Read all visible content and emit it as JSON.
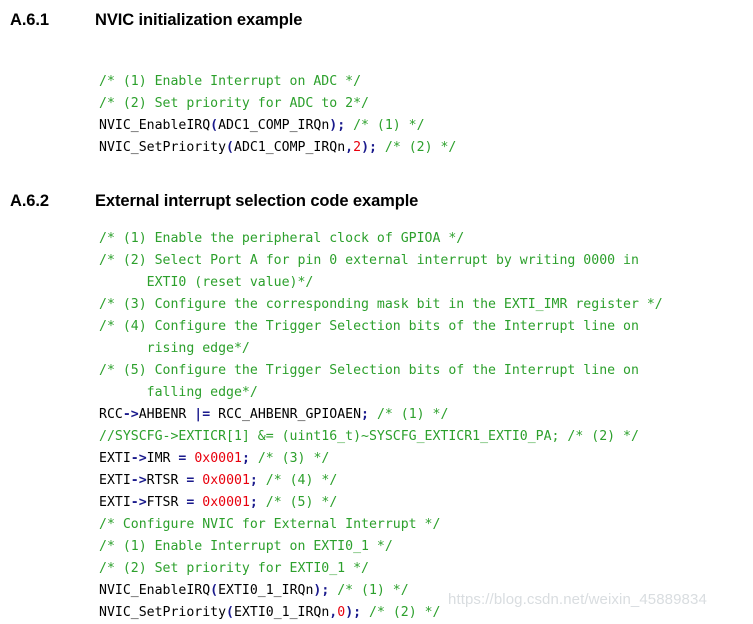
{
  "document": {
    "background_color": "#ffffff",
    "sections": [
      {
        "number": "A.6.1",
        "title": "NVIC initialization example",
        "code_lines": [
          [
            {
              "t": "comment",
              "s": "/* (1) Enable Interrupt on ADC */"
            }
          ],
          [
            {
              "t": "comment",
              "s": "/* (2) Set priority for ADC to 2*/"
            }
          ],
          [
            {
              "t": "plain",
              "s": "NVIC_EnableIRQ"
            },
            {
              "t": "punct",
              "s": "("
            },
            {
              "t": "plain",
              "s": "ADC1_COMP_IRQn"
            },
            {
              "t": "punct",
              "s": ");"
            },
            {
              "t": "comment",
              "s": " /* (1) */"
            }
          ],
          [
            {
              "t": "plain",
              "s": "NVIC_SetPriority"
            },
            {
              "t": "punct",
              "s": "("
            },
            {
              "t": "plain",
              "s": "ADC1_COMP_IRQn"
            },
            {
              "t": "punct",
              "s": ","
            },
            {
              "t": "number",
              "s": "2"
            },
            {
              "t": "punct",
              "s": ");"
            },
            {
              "t": "comment",
              "s": " /* (2) */"
            }
          ]
        ]
      },
      {
        "number": "A.6.2",
        "title": "External interrupt selection code example",
        "code_lines": [
          [
            {
              "t": "comment",
              "s": "/* (1) Enable the peripheral clock of GPIOA */"
            }
          ],
          [
            {
              "t": "comment",
              "s": "/* (2) Select Port A for pin 0 external interrupt by writing 0000 in"
            }
          ],
          [
            {
              "t": "comment",
              "s": "      EXTI0 (reset value)*/"
            }
          ],
          [
            {
              "t": "comment",
              "s": "/* (3) Configure the corresponding mask bit in the EXTI_IMR register */"
            }
          ],
          [
            {
              "t": "comment",
              "s": "/* (4) Configure the Trigger Selection bits of the Interrupt line on"
            }
          ],
          [
            {
              "t": "comment",
              "s": "      rising edge*/"
            }
          ],
          [
            {
              "t": "comment",
              "s": "/* (5) Configure the Trigger Selection bits of the Interrupt line on"
            }
          ],
          [
            {
              "t": "comment",
              "s": "      falling edge*/"
            }
          ],
          [
            {
              "t": "plain",
              "s": "RCC"
            },
            {
              "t": "op",
              "s": "->"
            },
            {
              "t": "plain",
              "s": "AHBENR "
            },
            {
              "t": "op",
              "s": "|="
            },
            {
              "t": "plain",
              "s": " RCC_AHBENR_GPIOAEN"
            },
            {
              "t": "punct",
              "s": ";"
            },
            {
              "t": "comment",
              "s": " /* (1) */"
            }
          ],
          [
            {
              "t": "comment",
              "s": "//SYSCFG->EXTICR[1] &= (uint16_t)~SYSCFG_EXTICR1_EXTI0_PA; /* (2) */"
            }
          ],
          [
            {
              "t": "plain",
              "s": "EXTI"
            },
            {
              "t": "op",
              "s": "->"
            },
            {
              "t": "plain",
              "s": "IMR "
            },
            {
              "t": "op",
              "s": "="
            },
            {
              "t": "plain",
              "s": " "
            },
            {
              "t": "number",
              "s": "0x0001"
            },
            {
              "t": "punct",
              "s": ";"
            },
            {
              "t": "comment",
              "s": " /* (3) */"
            }
          ],
          [
            {
              "t": "plain",
              "s": "EXTI"
            },
            {
              "t": "op",
              "s": "->"
            },
            {
              "t": "plain",
              "s": "RTSR "
            },
            {
              "t": "op",
              "s": "="
            },
            {
              "t": "plain",
              "s": " "
            },
            {
              "t": "number",
              "s": "0x0001"
            },
            {
              "t": "punct",
              "s": ";"
            },
            {
              "t": "comment",
              "s": " /* (4) */"
            }
          ],
          [
            {
              "t": "plain",
              "s": "EXTI"
            },
            {
              "t": "op",
              "s": "->"
            },
            {
              "t": "plain",
              "s": "FTSR "
            },
            {
              "t": "op",
              "s": "="
            },
            {
              "t": "plain",
              "s": " "
            },
            {
              "t": "number",
              "s": "0x0001"
            },
            {
              "t": "punct",
              "s": ";"
            },
            {
              "t": "comment",
              "s": " /* (5) */"
            }
          ],
          [
            {
              "t": "comment",
              "s": "/* Configure NVIC for External Interrupt */"
            }
          ],
          [
            {
              "t": "comment",
              "s": "/* (1) Enable Interrupt on EXTI0_1 */"
            }
          ],
          [
            {
              "t": "comment",
              "s": "/* (2) Set priority for EXTI0_1 */"
            }
          ],
          [
            {
              "t": "plain",
              "s": "NVIC_EnableIRQ"
            },
            {
              "t": "punct",
              "s": "("
            },
            {
              "t": "plain",
              "s": "EXTI0_1_IRQn"
            },
            {
              "t": "punct",
              "s": ");"
            },
            {
              "t": "comment",
              "s": " /* (1) */"
            }
          ],
          [
            {
              "t": "plain",
              "s": "NVIC_SetPriority"
            },
            {
              "t": "punct",
              "s": "("
            },
            {
              "t": "plain",
              "s": "EXTI0_1_IRQn"
            },
            {
              "t": "punct",
              "s": ","
            },
            {
              "t": "number",
              "s": "0"
            },
            {
              "t": "punct",
              "s": ");"
            },
            {
              "t": "comment",
              "s": " /* (2) */"
            }
          ]
        ]
      }
    ],
    "watermark": "https://blog.csdn.net/weixin_45889834",
    "syntax_colors": {
      "comment": "#2ca02c",
      "punctuation": "#1a1a8c",
      "operator": "#1a1a8c",
      "number": "#e8000d",
      "identifier": "#000000",
      "watermark": "#d9dde0"
    }
  }
}
